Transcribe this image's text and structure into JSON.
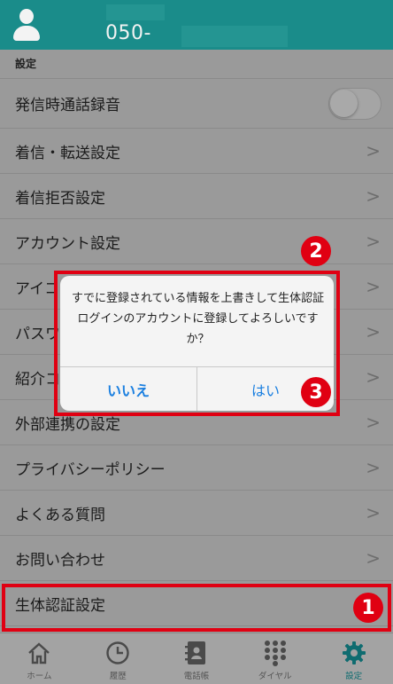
{
  "header": {
    "phone_prefix": "050-"
  },
  "section_label": "設定",
  "settings": [
    {
      "label": "発信時通話録音",
      "control": "toggle",
      "toggle_on": false
    },
    {
      "label": "着信・転送設定",
      "control": "chevron"
    },
    {
      "label": "着信拒否設定",
      "control": "chevron"
    },
    {
      "label": "アカウント設定",
      "control": "chevron"
    },
    {
      "label": "アイコ",
      "control": "chevron"
    },
    {
      "label": "パスワ",
      "control": "chevron"
    },
    {
      "label": "紹介コ",
      "control": "chevron"
    },
    {
      "label": "外部連携の設定",
      "control": "chevron"
    },
    {
      "label": "プライバシーポリシー",
      "control": "chevron"
    },
    {
      "label": "よくある質問",
      "control": "chevron"
    },
    {
      "label": "お問い合わせ",
      "control": "chevron"
    },
    {
      "label": "生体認証設定",
      "control": "none"
    }
  ],
  "chevron_glyph": ">",
  "dialog": {
    "message": "すでに登録されている情報を上書きして生体認証ログインのアカウントに登録してよろしいですか？",
    "cancel_label": "いいえ",
    "ok_label": "はい"
  },
  "annotations": {
    "badge_1": "1",
    "badge_2": "2",
    "badge_3": "3"
  },
  "tabs": [
    {
      "label": "ホーム",
      "icon": "home-icon",
      "active": false
    },
    {
      "label": "履歴",
      "icon": "clock-icon",
      "active": false
    },
    {
      "label": "電話帳",
      "icon": "contacts-book-icon",
      "active": false
    },
    {
      "label": "ダイヤル",
      "icon": "dialpad-icon",
      "active": false
    },
    {
      "label": "設定",
      "icon": "gear-icon",
      "active": true
    }
  ],
  "colors": {
    "header": "#1a8c8a",
    "annotation_red": "#e00012",
    "dialog_button_blue": "#1a7fe0",
    "active_tab": "#0f6c70"
  }
}
